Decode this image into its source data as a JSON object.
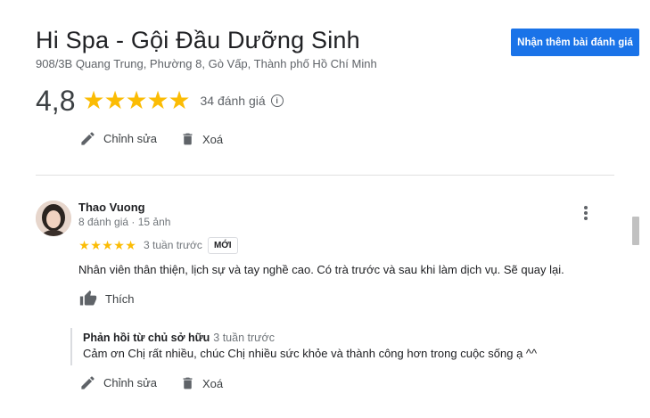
{
  "business": {
    "name": "Hi Spa - Gội Đầu Dưỡng Sinh",
    "address": "908/3B Quang Trung, Phường 8, Gò Vấp, Thành phố Hồ Chí Minh",
    "rating": "4,8",
    "stars_filled": 5,
    "review_count": "34 đánh giá",
    "ask_button": "Nhận thêm bài đánh giá"
  },
  "own_actions": {
    "edit_label": "Chỉnh sửa",
    "delete_label": "Xoá"
  },
  "review": {
    "author": "Thao Vuong",
    "meta": "8 đánh giá · 15 ảnh",
    "stars": 5,
    "time": "3 tuần trước",
    "badge": "MỚI",
    "text": "Nhân viên thân thiện, lịch sự và tay nghề cao. Có trà trước và sau khi làm dịch vụ. Sẽ quay lại.",
    "like_label": "Thích"
  },
  "owner_reply": {
    "heading": "Phản hồi từ chủ sở hữu",
    "time": "3 tuần trước",
    "text": "Cảm ơn Chị rất nhiều, chúc Chị nhiều sức khỏe và thành công hơn trong cuộc sống ạ ^^"
  },
  "reply_actions": {
    "edit_label": "Chỉnh sửa",
    "delete_label": "Xoá"
  },
  "colors": {
    "accent": "#1a73e8",
    "star": "#fbbc04"
  }
}
